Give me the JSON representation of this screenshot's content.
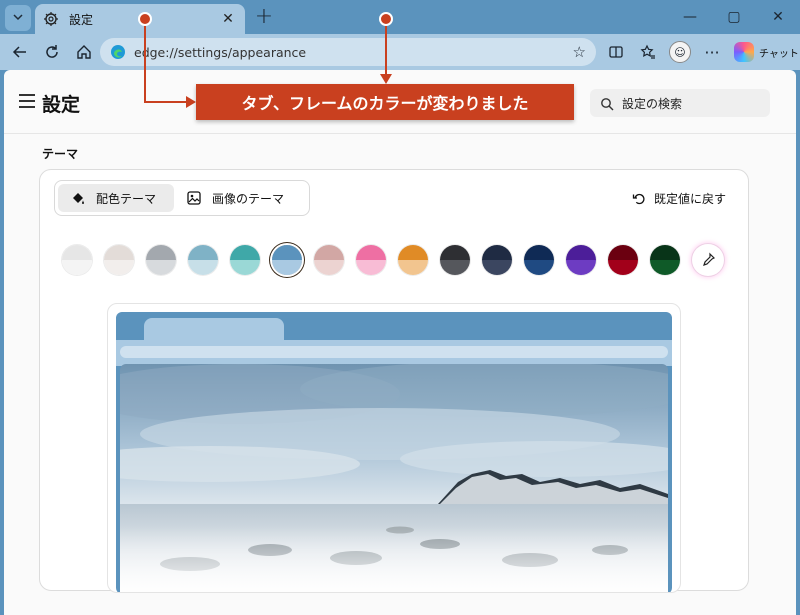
{
  "tab": {
    "title": "設定"
  },
  "address": {
    "url": "edge://settings/appearance"
  },
  "copilot": {
    "label": "チャット"
  },
  "header": {
    "title": "設定",
    "search_placeholder": "設定の検索"
  },
  "section": {
    "label": "テーマ"
  },
  "segments": [
    {
      "label": "配色テーマ",
      "active": true
    },
    {
      "label": "画像のテーマ",
      "active": false
    }
  ],
  "reset_label": "既定値に戻す",
  "swatches": [
    {
      "top": "#e6e6e6",
      "bottom": "#f4f4f4"
    },
    {
      "top": "#e3dcd8",
      "bottom": "#f2eeec"
    },
    {
      "top": "#a3a8ae",
      "bottom": "#d7dadd"
    },
    {
      "top": "#7fb2c6",
      "bottom": "#c7dfe8"
    },
    {
      "top": "#3fa8a8",
      "bottom": "#9ad8d6"
    },
    {
      "top": "#5b93bd",
      "bottom": "#a9c9e2",
      "selected": true
    },
    {
      "top": "#d2a7a4",
      "bottom": "#ecd3d1"
    },
    {
      "top": "#ee6fa3",
      "bottom": "#f8bcd5"
    },
    {
      "top": "#e08b26",
      "bottom": "#f2c58f"
    },
    {
      "top": "#2e2f33",
      "bottom": "#55575c"
    },
    {
      "top": "#1f2b43",
      "bottom": "#3b4660"
    },
    {
      "top": "#0f2a55",
      "bottom": "#1f4a82"
    },
    {
      "top": "#4c1e99",
      "bottom": "#6d3cc2"
    },
    {
      "top": "#6b0010",
      "bottom": "#a2001a"
    },
    {
      "top": "#083418",
      "bottom": "#0f5a28"
    }
  ],
  "annotation": {
    "text": "タブ、フレームのカラーが変わりました",
    "color": "#c9401f"
  }
}
